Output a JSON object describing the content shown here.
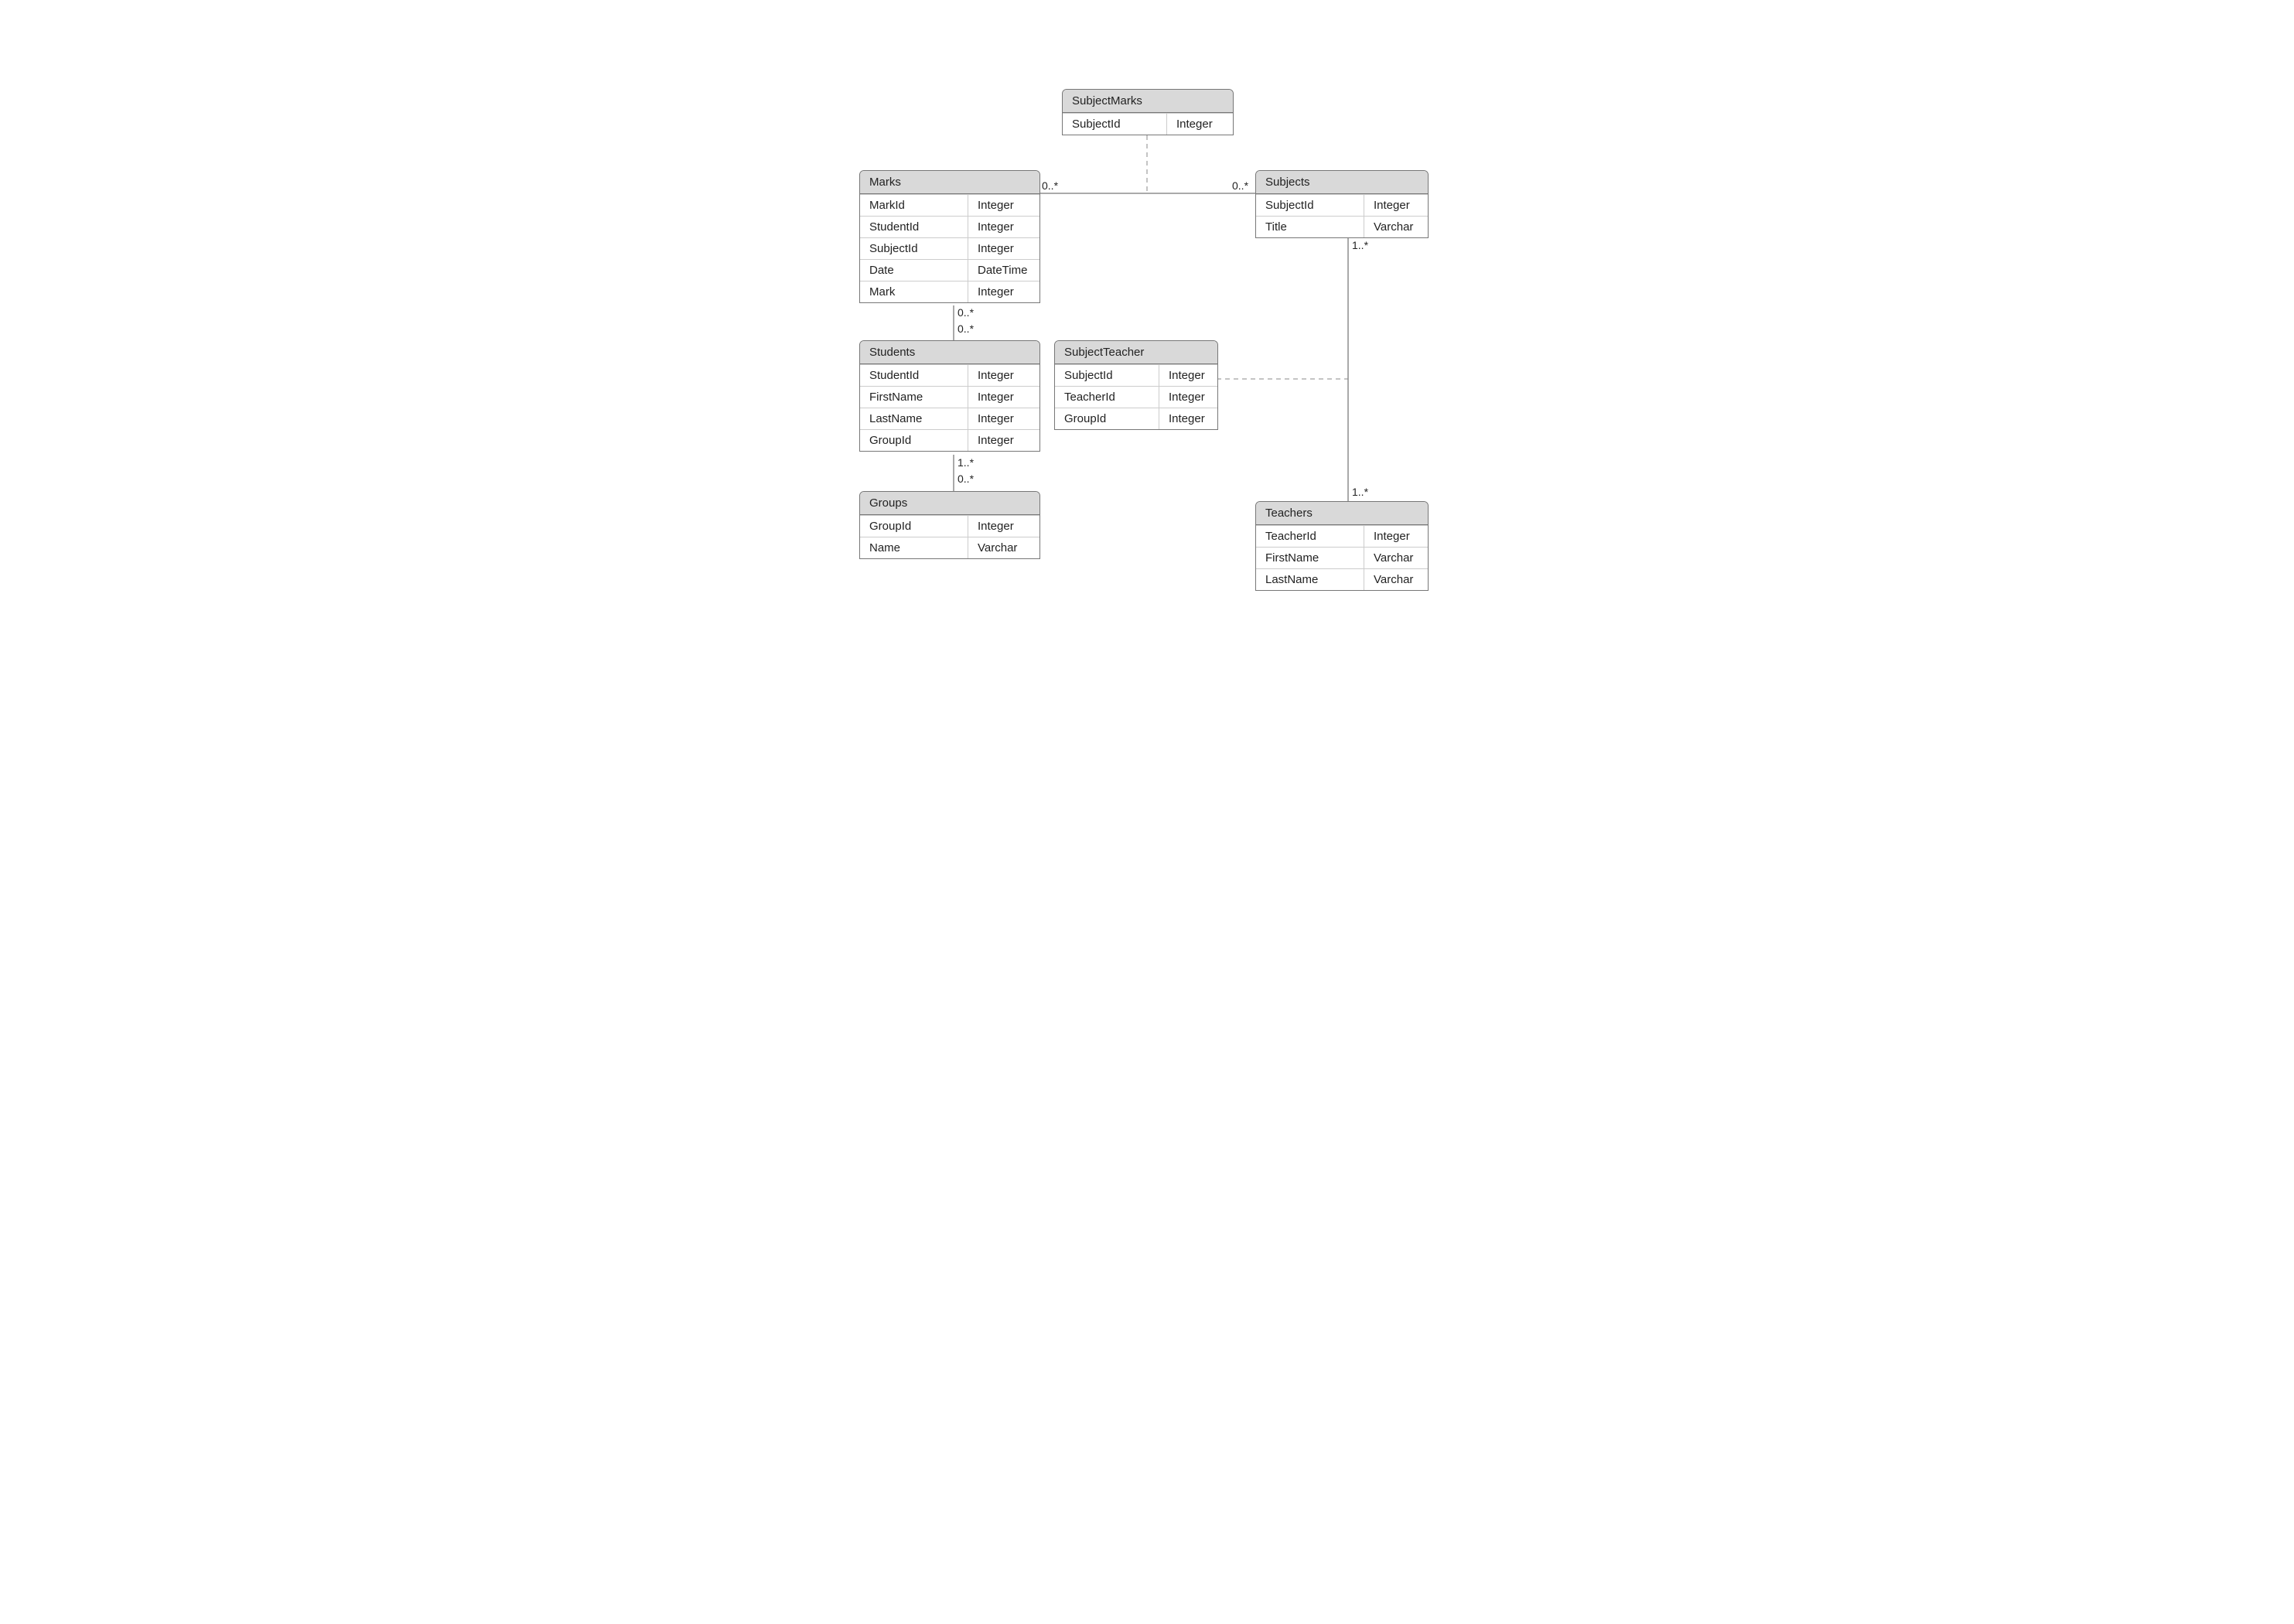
{
  "entities": {
    "subjectMarks": {
      "title": "SubjectMarks",
      "rows": [
        {
          "name": "SubjectId",
          "type": "Integer"
        }
      ]
    },
    "marks": {
      "title": "Marks",
      "rows": [
        {
          "name": "MarkId",
          "type": "Integer"
        },
        {
          "name": "StudentId",
          "type": "Integer"
        },
        {
          "name": "SubjectId",
          "type": "Integer"
        },
        {
          "name": "Date",
          "type": "DateTime"
        },
        {
          "name": "Mark",
          "type": "Integer"
        }
      ]
    },
    "subjects": {
      "title": "Subjects",
      "rows": [
        {
          "name": "SubjectId",
          "type": "Integer"
        },
        {
          "name": "Title",
          "type": "Varchar"
        }
      ]
    },
    "students": {
      "title": "Students",
      "rows": [
        {
          "name": "StudentId",
          "type": "Integer"
        },
        {
          "name": "FirstName",
          "type": "Integer"
        },
        {
          "name": "LastName",
          "type": "Integer"
        },
        {
          "name": "GroupId",
          "type": "Integer"
        }
      ]
    },
    "subjectTeacher": {
      "title": "SubjectTeacher",
      "rows": [
        {
          "name": "SubjectId",
          "type": "Integer"
        },
        {
          "name": "TeacherId",
          "type": "Integer"
        },
        {
          "name": "GroupId",
          "type": "Integer"
        }
      ]
    },
    "groups": {
      "title": "Groups",
      "rows": [
        {
          "name": "GroupId",
          "type": "Integer"
        },
        {
          "name": "Name",
          "type": "Varchar"
        }
      ]
    },
    "teachers": {
      "title": "Teachers",
      "rows": [
        {
          "name": "TeacherId",
          "type": "Integer"
        },
        {
          "name": "FirstName",
          "type": "Varchar"
        },
        {
          "name": "LastName",
          "type": "Varchar"
        }
      ]
    }
  },
  "multiplicities": {
    "marksSubjectsLeft": "0..*",
    "marksSubjectsRight": "0..*",
    "subjectsTeachersTop": "1..*",
    "subjectsTeachersBottom": "1..*",
    "marksStudentsTop": "0..*",
    "marksStudentsBottom": "0..*",
    "studentsGroupsTop": "1..*",
    "studentsGroupsBottom": "0..*"
  }
}
